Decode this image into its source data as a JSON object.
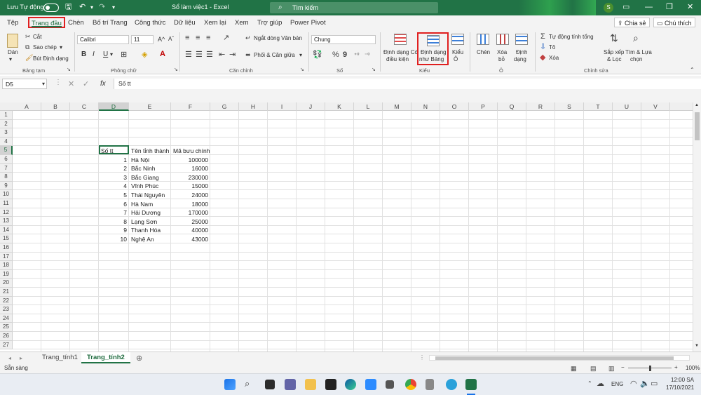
{
  "titlebar": {
    "autosave_label": "Lưu Tự động",
    "doc_title": "Sổ làm việc1  -  Excel",
    "search_placeholder": "Tìm kiếm",
    "user_initial": "S"
  },
  "menu": {
    "tabs": [
      "Tệp",
      "Trang đầu",
      "Chèn",
      "Bố trí Trang",
      "Công thức",
      "Dữ liệu",
      "Xem lại",
      "Xem",
      "Trợ giúp",
      "Power Pivot"
    ],
    "active_tab": "Trang đầu",
    "share": "Chia sẻ",
    "comments": "Chú thích"
  },
  "ribbon": {
    "clipboard": {
      "paste": "Dán",
      "cut": "Cắt",
      "copy": "Sao chép",
      "format_painter": "Bút Định dạng",
      "group": "Bảng tạm"
    },
    "font": {
      "name": "Calibri",
      "size": "11",
      "bold": "B",
      "italic": "I",
      "underline": "U",
      "grow": "A^",
      "shrink": "Aˇ",
      "group": "Phông chữ"
    },
    "alignment": {
      "wrap": "Ngắt dòng Văn bản",
      "merge": "Phối & Căn giữa",
      "group": "Căn chỉnh"
    },
    "number": {
      "format": "Chung",
      "group": "Số"
    },
    "styles": {
      "conditional_line1": "Định dạng Có",
      "conditional_line2": "điều kiện",
      "as_table_line1": "Định dạng",
      "as_table_line2": "như Bảng",
      "cell_styles_line1": "Kiểu",
      "cell_styles_line2": "Ô",
      "group": "Kiểu"
    },
    "cells": {
      "insert": "Chèn",
      "delete": "Xóa",
      "delete2": "bỏ",
      "format": "Định",
      "format2": "dạng",
      "group": "Ô"
    },
    "editing": {
      "autosum": "Tự động tính tổng",
      "fill": "Tô",
      "clear": "Xóa",
      "sort_line1": "Sắp xếp",
      "sort_line2": "& Lọc",
      "find_line1": "Tìm & Lựa",
      "find_line2": "chọn",
      "group": "Chỉnh sửa"
    }
  },
  "formula_bar": {
    "name_box": "D5",
    "fx": "fx",
    "content": "Số tt"
  },
  "columns": [
    "A",
    "B",
    "C",
    "D",
    "E",
    "F",
    "G",
    "H",
    "I",
    "J",
    "K",
    "L",
    "M",
    "N",
    "O",
    "P",
    "Q",
    "R",
    "S",
    "T",
    "U",
    "V"
  ],
  "selected_column": "D",
  "rows": [
    "1",
    "2",
    "3",
    "4",
    "5",
    "6",
    "7",
    "8",
    "9",
    "10",
    "11",
    "12",
    "13",
    "14",
    "15",
    "16",
    "17",
    "18",
    "19",
    "20",
    "21",
    "22",
    "23",
    "24",
    "25",
    "26",
    "27"
  ],
  "selected_row": "5",
  "table": {
    "headers": [
      "Số tt",
      "Tên tỉnh thành",
      "Mã bưu chính"
    ],
    "rows": [
      [
        "1",
        "Hà Nội",
        "100000"
      ],
      [
        "2",
        "Bắc Ninh",
        "16000"
      ],
      [
        "3",
        "Bắc Giang",
        "230000"
      ],
      [
        "4",
        "Vĩnh Phúc",
        "15000"
      ],
      [
        "5",
        "Thái Nguyên",
        "24000"
      ],
      [
        "6",
        "Hà Nam",
        "18000"
      ],
      [
        "7",
        "Hải Dương",
        "170000"
      ],
      [
        "8",
        "Lạng Sơn",
        "25000"
      ],
      [
        "9",
        "Thanh Hóa",
        "40000"
      ],
      [
        "10",
        "Nghệ An",
        "43000"
      ]
    ]
  },
  "sheets": [
    "Trang_tính1",
    "Trang_tính2"
  ],
  "active_sheet": "Trang_tính2",
  "status": {
    "ready": "Sẵn sàng",
    "zoom": "100%"
  },
  "taskbar": {
    "lang": "ENG",
    "time": "12:00 SA",
    "date": "17/10/2021"
  },
  "colors": {
    "excel_green": "#217346",
    "highlight_red": "#e02020"
  }
}
